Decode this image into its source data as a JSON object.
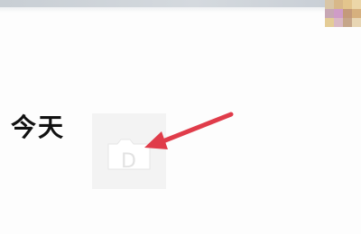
{
  "header": {
    "title": "今天"
  },
  "placeholder": {
    "icon": "broken-image-icon"
  },
  "annotation": {
    "icon": "arrow-pointer-icon",
    "color": "#e03c4a"
  },
  "avatar": {
    "icon": "blurred-avatar-icon"
  }
}
